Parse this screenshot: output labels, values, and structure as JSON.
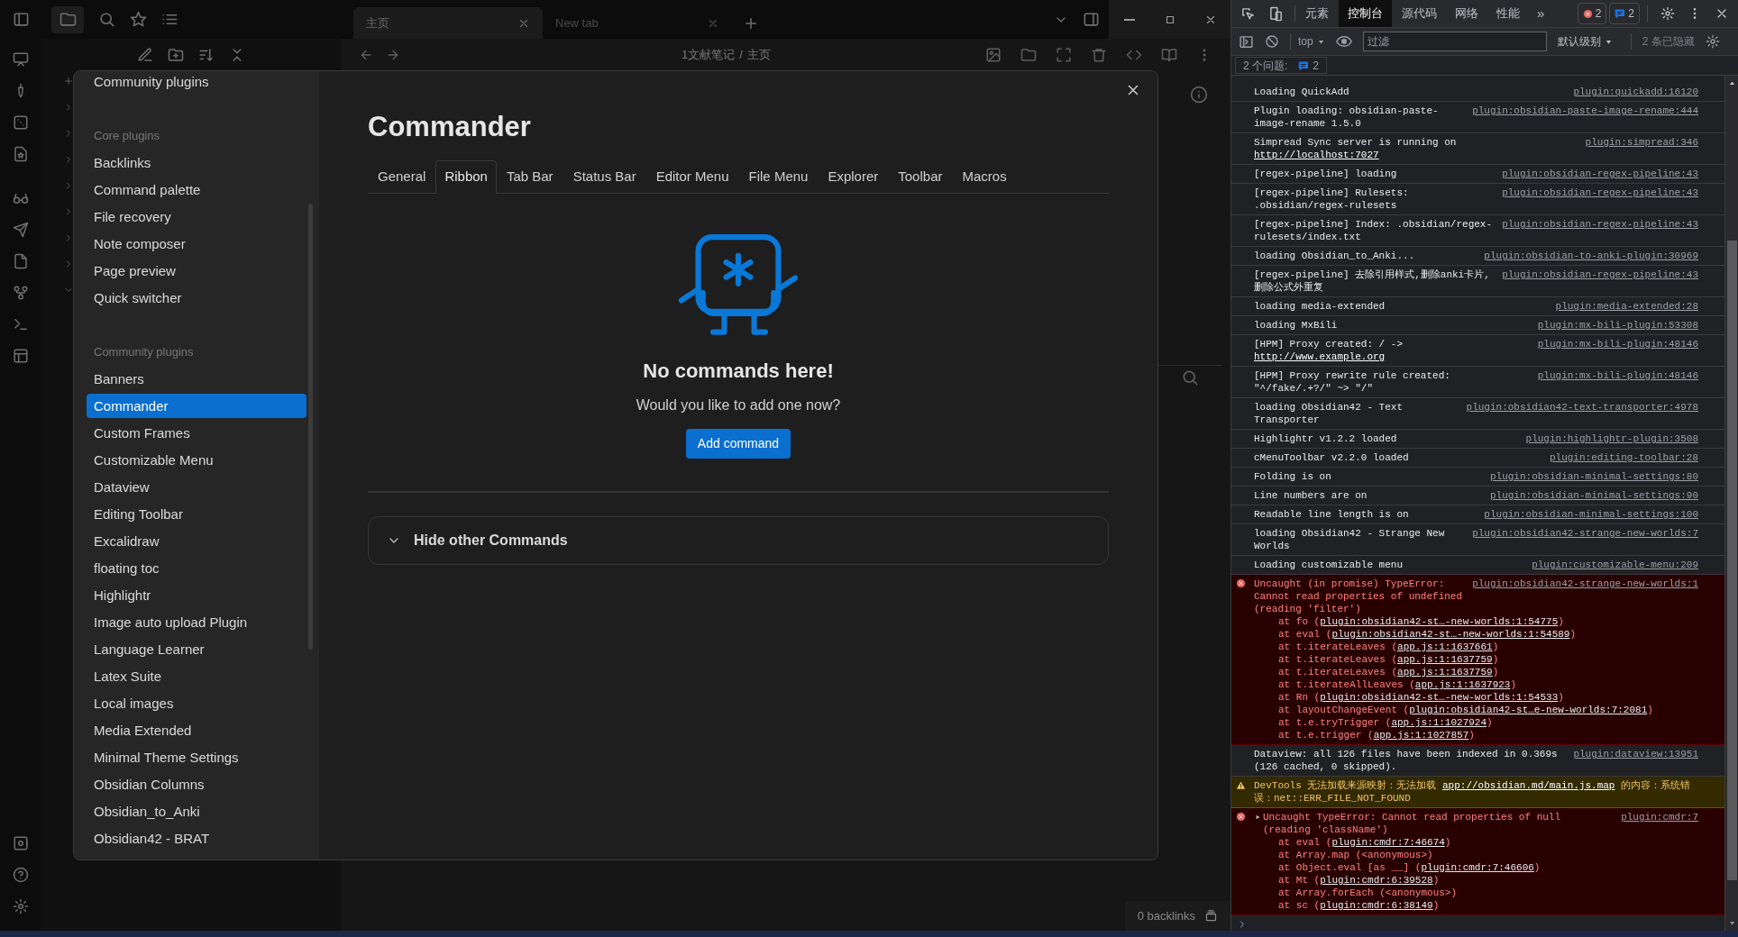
{
  "app": {
    "tabs": [
      {
        "label": "主页",
        "selected": true
      },
      {
        "label": "New tab",
        "selected": false
      }
    ],
    "breadcrumb": {
      "folder": "1文献笔记",
      "separator": "/",
      "note": "主页"
    },
    "status_bar": {
      "backlinks": "0 backlinks"
    }
  },
  "modal": {
    "sidebar": {
      "top_item": "Community plugins",
      "groups": [
        {
          "heading": "Core plugins",
          "items": [
            {
              "label": "Backlinks",
              "selected": false
            },
            {
              "label": "Command palette",
              "selected": false
            },
            {
              "label": "File recovery",
              "selected": false
            },
            {
              "label": "Note composer",
              "selected": false
            },
            {
              "label": "Page preview",
              "selected": false
            },
            {
              "label": "Quick switcher",
              "selected": false
            }
          ]
        },
        {
          "heading": "Community plugins",
          "items": [
            {
              "label": "Banners",
              "selected": false
            },
            {
              "label": "Commander",
              "selected": true
            },
            {
              "label": "Custom Frames",
              "selected": false
            },
            {
              "label": "Customizable Menu",
              "selected": false
            },
            {
              "label": "Dataview",
              "selected": false
            },
            {
              "label": "Editing Toolbar",
              "selected": false
            },
            {
              "label": "Excalidraw",
              "selected": false
            },
            {
              "label": "floating toc",
              "selected": false
            },
            {
              "label": "Highlightr",
              "selected": false
            },
            {
              "label": "Image auto upload Plugin",
              "selected": false
            },
            {
              "label": "Language Learner",
              "selected": false
            },
            {
              "label": "Latex Suite",
              "selected": false
            },
            {
              "label": "Local images",
              "selected": false
            },
            {
              "label": "Media Extended",
              "selected": false
            },
            {
              "label": "Minimal Theme Settings",
              "selected": false
            },
            {
              "label": "Obsidian Columns",
              "selected": false
            },
            {
              "label": "Obsidian_to_Anki",
              "selected": false
            },
            {
              "label": "Obsidian42 - BRAT",
              "selected": false
            }
          ]
        }
      ]
    },
    "title": "Commander",
    "tabs": [
      {
        "label": "General",
        "selected": false
      },
      {
        "label": "Ribbon",
        "selected": true
      },
      {
        "label": "Tab Bar",
        "selected": false
      },
      {
        "label": "Status Bar",
        "selected": false
      },
      {
        "label": "Editor Menu",
        "selected": false
      },
      {
        "label": "File Menu",
        "selected": false
      },
      {
        "label": "Explorer",
        "selected": false
      },
      {
        "label": "Toolbar",
        "selected": false
      },
      {
        "label": "Macros",
        "selected": false
      }
    ],
    "empty_state": {
      "heading": "No commands here!",
      "text": "Would you like to add one now?",
      "button": "Add command"
    },
    "section": {
      "label": "Hide other Commands"
    }
  },
  "devtools": {
    "tabs": [
      {
        "label": "元素",
        "selected": false
      },
      {
        "label": "控制台",
        "selected": true
      },
      {
        "label": "源代码",
        "selected": false
      },
      {
        "label": "网络",
        "selected": false
      },
      {
        "label": "性能",
        "selected": false
      }
    ],
    "more": "»",
    "error_count": "2",
    "message_count": "2",
    "context": "top",
    "filter": {
      "placeholder": "过滤"
    },
    "level": "默认级别",
    "hidden": "2 条已隐藏",
    "issues": {
      "label": "2 个问题:",
      "count": "2"
    },
    "entries": [
      {
        "kind": "log",
        "disclosure": false,
        "text": "Loading QuickAdd",
        "source": "plugin:quickadd:16120"
      },
      {
        "kind": "log",
        "disclosure": false,
        "text": "Plugin loading: obsidian-paste-image-rename 1.5.0",
        "source": "plugin:obsidian-paste-image-rename:444"
      },
      {
        "kind": "log",
        "disclosure": false,
        "text": "Simpread Sync server is running on ",
        "url": "http://localhost:7027",
        "source": "plugin:simpread:346"
      },
      {
        "kind": "log",
        "disclosure": false,
        "text": "[regex-pipeline] loading",
        "source": "plugin:obsidian-regex-pipeline:43"
      },
      {
        "kind": "log",
        "disclosure": false,
        "text": "[regex-pipeline] Rulesets: .obsidian/regex-rulesets",
        "source": "plugin:obsidian-regex-pipeline:43"
      },
      {
        "kind": "log",
        "disclosure": false,
        "text": "[regex-pipeline] Index: .obsidian/regex-rulesets/index.txt",
        "source": "plugin:obsidian-regex-pipeline:43"
      },
      {
        "kind": "log",
        "disclosure": false,
        "text": "loading Obsidian_to_Anki...",
        "source": "plugin:obsidian-to-anki-plugin:30969"
      },
      {
        "kind": "log",
        "disclosure": false,
        "text": "[regex-pipeline] 去除引用样式,删除anki卡片,删除公式外重复",
        "source": "plugin:obsidian-regex-pipeline:43"
      },
      {
        "kind": "log",
        "disclosure": false,
        "text": "loading media-extended",
        "source": "plugin:media-extended:28"
      },
      {
        "kind": "log",
        "disclosure": false,
        "text": "loading MxBili",
        "source": "plugin:mx-bili-plugin:53308"
      },
      {
        "kind": "log",
        "disclosure": false,
        "text": "[HPM] Proxy created: /  -> ",
        "url": "http://www.example.org",
        "source": "plugin:mx-bili-plugin:48146"
      },
      {
        "kind": "log",
        "disclosure": false,
        "text": "[HPM] Proxy rewrite rule created: \"^/fake/.+?/\" ~> \"/\"",
        "source": "plugin:mx-bili-plugin:48146"
      },
      {
        "kind": "log",
        "disclosure": false,
        "text": "loading Obsidian42 - Text Transporter",
        "source": "plugin:obsidian42-text-transporter:4978"
      },
      {
        "kind": "log",
        "disclosure": false,
        "text": "Highlightr v1.2.2 loaded",
        "source": "plugin:highlightr-plugin:3508"
      },
      {
        "kind": "log",
        "disclosure": false,
        "text": "cMenuToolbar v2.2.0 loaded",
        "source": "plugin:editing-toolbar:28"
      },
      {
        "kind": "log",
        "disclosure": false,
        "text": "Folding is on",
        "source": "plugin:obsidian-minimal-settings:80"
      },
      {
        "kind": "log",
        "disclosure": false,
        "text": "Line numbers are on",
        "source": "plugin:obsidian-minimal-settings:90"
      },
      {
        "kind": "log",
        "disclosure": false,
        "text": "Readable line length is on",
        "source": "plugin:obsidian-minimal-settings:100"
      },
      {
        "kind": "log",
        "disclosure": false,
        "text": "loading Obsidian42 - Strange New Worlds",
        "source": "plugin:obsidian42-strange-new-worlds:7"
      },
      {
        "kind": "log",
        "disclosure": false,
        "text": "Loading customizable menu",
        "source": "plugin:customizable-menu:209"
      },
      {
        "kind": "error",
        "disclosure": false,
        "text": "Uncaught (in promise) TypeError: Cannot read properties of undefined (reading 'filter')",
        "source": "plugin:obsidian42-strange-new-worlds:1",
        "frames": [
          {
            "prefix": "at fo (",
            "loc": "plugin:obsidian42-st…-new-worlds:1:54775",
            "suffix": ")",
            "link": true
          },
          {
            "prefix": "at eval (",
            "loc": "plugin:obsidian42-st…-new-worlds:1:54589",
            "suffix": ")",
            "link": true
          },
          {
            "prefix": "at t.iterateLeaves (",
            "loc": "app.js:1:1637661",
            "suffix": ")",
            "link": true
          },
          {
            "prefix": "at t.iterateLeaves (",
            "loc": "app.js:1:1637759",
            "suffix": ")",
            "link": true
          },
          {
            "prefix": "at t.iterateLeaves (",
            "loc": "app.js:1:1637759",
            "suffix": ")",
            "link": true
          },
          {
            "prefix": "at t.iterateAllLeaves (",
            "loc": "app.js:1:1637923",
            "suffix": ")",
            "link": true
          },
          {
            "prefix": "at Rn (",
            "loc": "plugin:obsidian42-st…-new-worlds:1:54533",
            "suffix": ")",
            "link": true
          },
          {
            "prefix": "at layoutChangeEvent (",
            "loc": "plugin:obsidian42-st…e-new-worlds:7:2081",
            "suffix": ")",
            "link": true
          },
          {
            "prefix": "at t.e.tryTrigger (",
            "loc": "app.js:1:1027924",
            "suffix": ")",
            "link": true
          },
          {
            "prefix": "at t.e.trigger (",
            "loc": "app.js:1:1027857",
            "suffix": ")",
            "link": true
          }
        ]
      },
      {
        "kind": "log",
        "disclosure": false,
        "text": "Dataview: all 126 files have been indexed in 0.369s (126 cached, 0 skipped).",
        "source": "plugin:dataview:13951"
      },
      {
        "kind": "warning",
        "disclosure": false,
        "text": "DevTools 无法加载来源映射：无法加载 ",
        "url": "app://obsidian.md/main.js.map",
        "text_after": " 的内容：系统错误：net::ERR_FILE_NOT_FOUND"
      },
      {
        "kind": "error",
        "disclosure": true,
        "text": "Uncaught TypeError: Cannot read properties of null (reading 'className')",
        "source": "plugin:cmdr:7",
        "frames": [
          {
            "prefix": "at eval (",
            "loc": "plugin:cmdr:7:46674",
            "suffix": ")",
            "link": true
          },
          {
            "prefix": "at Array.map (",
            "loc": "<anonymous>",
            "suffix": ")",
            "link": false
          },
          {
            "prefix": "at Object.eval [as __] (",
            "loc": "plugin:cmdr:7:46606",
            "suffix": ")",
            "link": true
          },
          {
            "prefix": "at Mt (",
            "loc": "plugin:cmdr:6:39528",
            "suffix": ")",
            "link": true
          },
          {
            "prefix": "at Array.forEach (",
            "loc": "<anonymous>",
            "suffix": ")",
            "link": false
          },
          {
            "prefix": "at sc (",
            "loc": "plugin:cmdr:6:38149",
            "suffix": ")",
            "link": true
          }
        ]
      }
    ]
  }
}
